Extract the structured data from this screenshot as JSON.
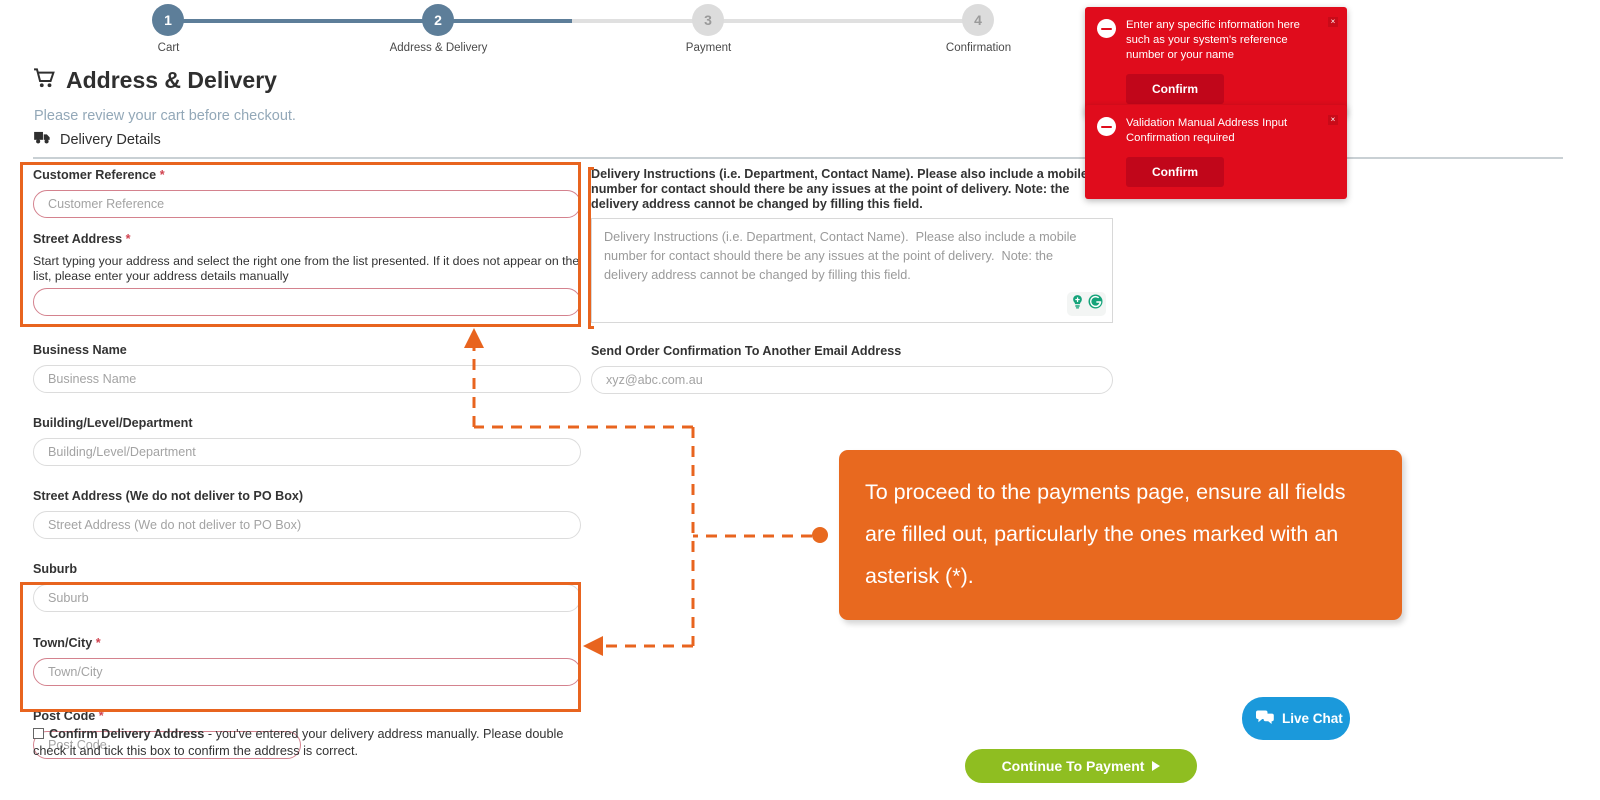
{
  "stepper": {
    "steps": [
      {
        "num": "1",
        "label": "Cart",
        "state": "active"
      },
      {
        "num": "2",
        "label": "Address & Delivery",
        "state": "active"
      },
      {
        "num": "3",
        "label": "Payment",
        "state": "inactive"
      },
      {
        "num": "4",
        "label": "Confirmation",
        "state": "inactive"
      }
    ],
    "active_color": "#5d7e99",
    "inactive_color": "#dcdcdc"
  },
  "header": {
    "title": "Address & Delivery",
    "cart_icon": "shopping-cart-icon",
    "subtitle": "Please review your cart before checkout.",
    "section_title": "Delivery Details",
    "truck_icon": "delivery-truck-icon"
  },
  "form": {
    "left": {
      "customer_reference": {
        "label": "Customer Reference",
        "required": "*",
        "placeholder": "Customer Reference",
        "value": ""
      },
      "street_address_lookup": {
        "label": "Street Address",
        "required": "*",
        "help": "Start typing your address and select the right one from the list presented. If it does not appear on the list, please enter your address details manually",
        "placeholder": "",
        "value": ""
      },
      "business_name": {
        "label": "Business Name",
        "placeholder": "Business Name",
        "value": ""
      },
      "building_level_department": {
        "label": "Building/Level/Department",
        "placeholder": "Building/Level/Department",
        "value": ""
      },
      "street_address": {
        "label": "Street Address (We do not deliver to PO Box)",
        "placeholder": "Street Address (We do not deliver to PO Box)",
        "value": ""
      },
      "suburb": {
        "label": "Suburb",
        "placeholder": "Suburb",
        "value": ""
      },
      "town_city": {
        "label": "Town/City",
        "required": "*",
        "placeholder": "Town/City",
        "value": ""
      },
      "post_code": {
        "label": "Post Code",
        "required": "*",
        "placeholder": "Post Code",
        "value": ""
      }
    },
    "right": {
      "delivery_instructions": {
        "label": "Delivery Instructions (i.e. Department, Contact Name). Please also include a mobile number for contact should there be any issues at the point of delivery. Note: the delivery address cannot be changed by filling this field.",
        "placeholder": "Delivery Instructions (i.e. Department, Contact Name).  Please also include a mobile number for contact should there be any issues at the point of delivery.  Note: the delivery address cannot be changed by filling this field.",
        "value": "",
        "grammarly_icons": [
          "lightbulb-icon",
          "grammarly-g-icon"
        ]
      },
      "confirmation_email": {
        "label": "Send Order Confirmation To Another Email Address",
        "placeholder": "xyz@abc.com.au",
        "value": ""
      }
    },
    "confirm_checkbox": {
      "checked": false,
      "strong_label": "Confirm Delivery Address",
      "rest_label": " - you've entered your delivery address manually. Please double check it and tick this box to confirm the address is correct."
    }
  },
  "toasts": [
    {
      "message": "Enter any specific information here such as your system's reference number or your name",
      "button": "Confirm",
      "close": "×",
      "icon": "minus-circle-icon",
      "color": "#e00c1c"
    },
    {
      "message": "Validation Manual Address Input Confirmation required",
      "button": "Confirm",
      "close": "×",
      "icon": "minus-circle-icon",
      "color": "#e00c1c"
    }
  ],
  "callout": {
    "text": "To proceed to the payments page, ensure all fields are filled out, particularly the ones marked with an asterisk (*).",
    "color": "#e8691f"
  },
  "buttons": {
    "continue": {
      "label": "Continue To Payment",
      "color": "#8fbe21",
      "icon": "play-arrow-icon"
    },
    "live_chat": {
      "label": "Live Chat",
      "color": "#1b99db",
      "icon": "chat-bubbles-icon"
    }
  }
}
